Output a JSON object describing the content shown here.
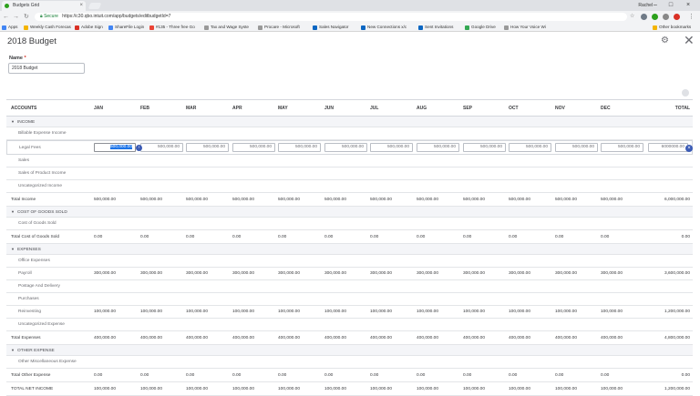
{
  "browser": {
    "tab_title": "Budgets Grid",
    "user_name": "Rachel",
    "secure_label": "Secure",
    "url": "https://c30.qbo.intuit.com/app/budgets/editbudgetId=7",
    "bookmarks": [
      "Apps",
      "Weekly Cash Forecas",
      "Adobe Sign",
      "ShareFile Login",
      "#135 - Three free Go",
      "Tax and Wage Syste",
      "Procare - Microsoft",
      "Sales Navigator",
      "New Connections x/c",
      "Sent Invitations",
      "Google Drive",
      "How Your Voice Wi",
      "Other bookmarks"
    ]
  },
  "page": {
    "title": "2018 Budget",
    "name_label": "Name",
    "name_required": "*",
    "name_value": "2018 Budget"
  },
  "columns": [
    "ACCOUNTS",
    "JAN",
    "FEB",
    "MAR",
    "APR",
    "MAY",
    "JUN",
    "JUL",
    "AUG",
    "SEP",
    "OCT",
    "NOV",
    "DEC",
    "TOTAL"
  ],
  "editing_row": {
    "label": "Legal Fees",
    "values": [
      "500,000.00",
      "500,000.00",
      "500,000.00",
      "500,000.00",
      "500,000.00",
      "500,000.00",
      "500,000.00",
      "500,000.00",
      "500,000.00",
      "500,000.00",
      "500,000.00",
      "500,000.00"
    ],
    "total": "6000000.00"
  },
  "rows": [
    {
      "label": "INCOME",
      "type": "section"
    },
    {
      "label": "Billable Expense Income",
      "type": "child",
      "values": []
    },
    {
      "label": "Legal Fees",
      "type": "editing"
    },
    {
      "label": "Sales",
      "type": "child",
      "values": []
    },
    {
      "label": "Sales of Product Income",
      "type": "child",
      "values": []
    },
    {
      "label": "Uncategorized Income",
      "type": "child",
      "values": []
    },
    {
      "label": "Total Income",
      "type": "total",
      "values": [
        "500,000.00",
        "500,000.00",
        "500,000.00",
        "500,000.00",
        "500,000.00",
        "500,000.00",
        "500,000.00",
        "500,000.00",
        "500,000.00",
        "500,000.00",
        "500,000.00",
        "500,000.00",
        "6,000,000.00"
      ]
    },
    {
      "label": "COST OF GOODS SOLD",
      "type": "section"
    },
    {
      "label": "Cost of Goods Sold",
      "type": "child",
      "values": []
    },
    {
      "label": "Total Cost of Goods Sold",
      "type": "total",
      "values": [
        "0.00",
        "0.00",
        "0.00",
        "0.00",
        "0.00",
        "0.00",
        "0.00",
        "0.00",
        "0.00",
        "0.00",
        "0.00",
        "0.00",
        "0.00"
      ]
    },
    {
      "label": "EXPENSES",
      "type": "section"
    },
    {
      "label": "Office Expenses",
      "type": "child",
      "values": []
    },
    {
      "label": "Payroll",
      "type": "child",
      "values": [
        "300,000.00",
        "300,000.00",
        "300,000.00",
        "300,000.00",
        "300,000.00",
        "300,000.00",
        "300,000.00",
        "300,000.00",
        "300,000.00",
        "300,000.00",
        "300,000.00",
        "300,000.00",
        "3,600,000.00"
      ]
    },
    {
      "label": "Postage And Delivery",
      "type": "child",
      "values": []
    },
    {
      "label": "Purchases",
      "type": "child",
      "values": []
    },
    {
      "label": "Reinvesting",
      "type": "child",
      "values": [
        "100,000.00",
        "100,000.00",
        "100,000.00",
        "100,000.00",
        "100,000.00",
        "100,000.00",
        "100,000.00",
        "100,000.00",
        "100,000.00",
        "100,000.00",
        "100,000.00",
        "100,000.00",
        "1,200,000.00"
      ]
    },
    {
      "label": "Uncategorized Expense",
      "type": "child",
      "values": []
    },
    {
      "label": "Total Expenses",
      "type": "total",
      "values": [
        "400,000.00",
        "400,000.00",
        "400,000.00",
        "400,000.00",
        "400,000.00",
        "400,000.00",
        "400,000.00",
        "400,000.00",
        "400,000.00",
        "400,000.00",
        "400,000.00",
        "400,000.00",
        "4,800,000.00"
      ]
    },
    {
      "label": "OTHER EXPENSE",
      "type": "section"
    },
    {
      "label": "Other Miscellaneous Expense",
      "type": "child",
      "values": []
    },
    {
      "label": "Total Other Expense",
      "type": "total",
      "values": [
        "0.00",
        "0.00",
        "0.00",
        "0.00",
        "0.00",
        "0.00",
        "0.00",
        "0.00",
        "0.00",
        "0.00",
        "0.00",
        "0.00",
        "0.00"
      ]
    },
    {
      "label": "TOTAL NET INCOME",
      "type": "net",
      "values": [
        "100,000.00",
        "100,000.00",
        "100,000.00",
        "100,000.00",
        "100,000.00",
        "100,000.00",
        "100,000.00",
        "100,000.00",
        "100,000.00",
        "100,000.00",
        "100,000.00",
        "100,000.00",
        "1,200,000.00"
      ]
    }
  ]
}
